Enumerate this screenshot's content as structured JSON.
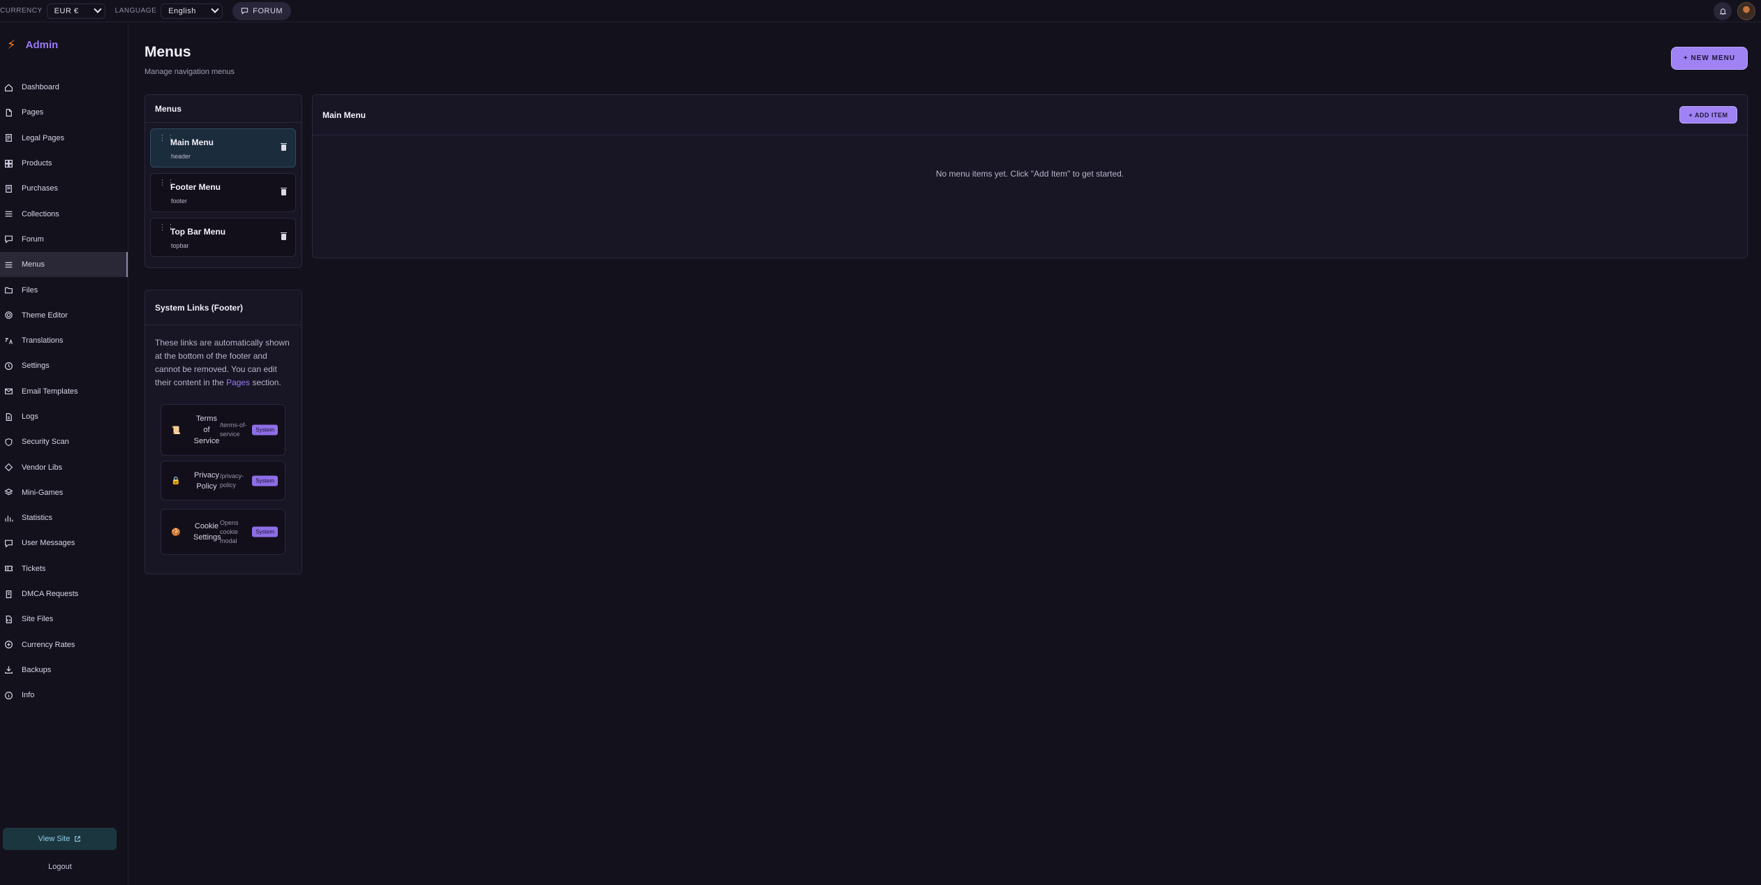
{
  "topbar": {
    "currency_label": "CURRENCY",
    "currency_value": "EUR €",
    "language_label": "LANGUAGE",
    "language_value": "English",
    "forum_label": "FORUM"
  },
  "sidebar": {
    "brand": "Admin",
    "items": [
      {
        "label": "Dashboard",
        "icon": "home-icon"
      },
      {
        "label": "Pages",
        "icon": "file-icon"
      },
      {
        "label": "Legal Pages",
        "icon": "legal-icon"
      },
      {
        "label": "Products",
        "icon": "grid-icon"
      },
      {
        "label": "Purchases",
        "icon": "receipt-icon"
      },
      {
        "label": "Collections",
        "icon": "list-icon"
      },
      {
        "label": "Forum",
        "icon": "chat-icon"
      },
      {
        "label": "Menus",
        "icon": "menu-icon",
        "active": true
      },
      {
        "label": "Files",
        "icon": "folder-icon"
      },
      {
        "label": "Theme Editor",
        "icon": "gear-icon"
      },
      {
        "label": "Translations",
        "icon": "translate-icon"
      },
      {
        "label": "Settings",
        "icon": "settings-icon"
      },
      {
        "label": "Email Templates",
        "icon": "mail-icon"
      },
      {
        "label": "Logs",
        "icon": "doc-icon"
      },
      {
        "label": "Security Scan",
        "icon": "shield-icon"
      },
      {
        "label": "Vendor Libs",
        "icon": "package-icon"
      },
      {
        "label": "Mini-Games",
        "icon": "layers-icon"
      },
      {
        "label": "Statistics",
        "icon": "bar-chart-icon"
      },
      {
        "label": "User Messages",
        "icon": "message-icon"
      },
      {
        "label": "Tickets",
        "icon": "ticket-icon"
      },
      {
        "label": "DMCA Requests",
        "icon": "scale-icon"
      },
      {
        "label": "Site Files",
        "icon": "file-code-icon"
      },
      {
        "label": "Currency Rates",
        "icon": "coin-icon"
      },
      {
        "label": "Backups",
        "icon": "download-icon"
      },
      {
        "label": "Info",
        "icon": "info-icon"
      }
    ],
    "view_site": "View Site",
    "logout": "Logout"
  },
  "page": {
    "title": "Menus",
    "subtitle": "Manage navigation menus",
    "new_menu": "+ NEW MENU"
  },
  "menus_panel": {
    "title": "Menus",
    "items": [
      {
        "name": "Main Menu",
        "location": "header",
        "selected": true
      },
      {
        "name": "Footer Menu",
        "location": "footer"
      },
      {
        "name": "Top Bar Menu",
        "location": "topbar"
      }
    ]
  },
  "editor": {
    "title": "Main Menu",
    "add_item": "+ ADD ITEM",
    "empty_text": "No menu items yet. Click \"Add Item\" to get started."
  },
  "system_links": {
    "title": "System Links (Footer)",
    "desc_before": "These links are automatically shown at the bottom of the footer and cannot be removed. You can edit their content in the ",
    "desc_link": "Pages",
    "desc_after": " section.",
    "items": [
      {
        "name": "Terms of Service",
        "path": "/terms-of-service",
        "badge": "System",
        "icon": "scroll-icon"
      },
      {
        "name": "Privacy Policy",
        "path": "/privacy-policy",
        "badge": "System",
        "icon": "lock-icon"
      },
      {
        "name": "Cookie Settings",
        "path": "Opens cookie modal",
        "badge": "System",
        "icon": "cookie-icon"
      }
    ]
  },
  "colors": {
    "background": "#13111c",
    "accent": "#9f82f3",
    "brand": "#9a7af5",
    "bolt": "#f47b2a"
  }
}
